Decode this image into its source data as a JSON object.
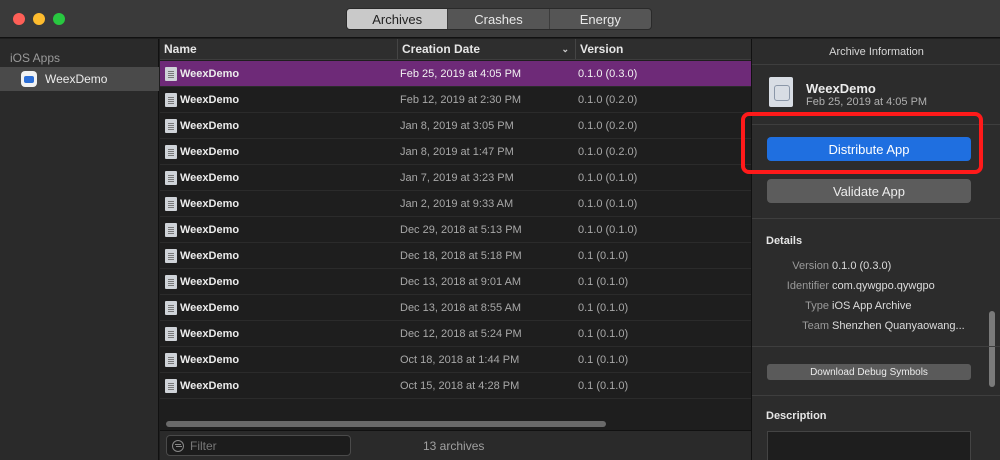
{
  "titlebar": {
    "tabs": [
      {
        "label": "Archives",
        "active": true
      },
      {
        "label": "Crashes",
        "active": false
      },
      {
        "label": "Energy",
        "active": false
      }
    ]
  },
  "sidebar": {
    "header": "iOS Apps",
    "items": [
      {
        "label": "WeexDemo",
        "icon": "app-icon",
        "selected": true
      }
    ]
  },
  "table": {
    "columns": {
      "name": "Name",
      "date": "Creation Date",
      "version": "Version"
    },
    "rows": [
      {
        "name": "WeexDemo",
        "date": "Feb 25, 2019 at 4:05 PM",
        "version": "0.1.0 (0.3.0)"
      },
      {
        "name": "WeexDemo",
        "date": "Feb 12, 2019 at 2:30 PM",
        "version": "0.1.0 (0.2.0)"
      },
      {
        "name": "WeexDemo",
        "date": "Jan 8, 2019 at 3:05 PM",
        "version": "0.1.0 (0.2.0)"
      },
      {
        "name": "WeexDemo",
        "date": "Jan 8, 2019 at 1:47 PM",
        "version": "0.1.0 (0.2.0)"
      },
      {
        "name": "WeexDemo",
        "date": "Jan 7, 2019 at 3:23 PM",
        "version": "0.1.0 (0.1.0)"
      },
      {
        "name": "WeexDemo",
        "date": "Jan 2, 2019 at 9:33 AM",
        "version": "0.1.0 (0.1.0)"
      },
      {
        "name": "WeexDemo",
        "date": "Dec 29, 2018 at 5:13 PM",
        "version": "0.1.0 (0.1.0)"
      },
      {
        "name": "WeexDemo",
        "date": "Dec 18, 2018 at 5:18 PM",
        "version": "0.1 (0.1.0)"
      },
      {
        "name": "WeexDemo",
        "date": "Dec 13, 2018 at 9:01 AM",
        "version": "0.1 (0.1.0)"
      },
      {
        "name": "WeexDemo",
        "date": "Dec 13, 2018 at 8:55 AM",
        "version": "0.1 (0.1.0)"
      },
      {
        "name": "WeexDemo",
        "date": "Dec 12, 2018 at 5:24 PM",
        "version": "0.1 (0.1.0)"
      },
      {
        "name": "WeexDemo",
        "date": "Oct 18, 2018 at 1:44 PM",
        "version": "0.1 (0.1.0)"
      },
      {
        "name": "WeexDemo",
        "date": "Oct 15, 2018 at 4:28 PM",
        "version": "0.1 (0.1.0)"
      }
    ],
    "filter_placeholder": "Filter",
    "count_label": "13 archives"
  },
  "inspector": {
    "header": "Archive Information",
    "title": "WeexDemo",
    "subtitle": "Feb 25, 2019 at 4:05 PM",
    "distribute_label": "Distribute App",
    "validate_label": "Validate App",
    "details_title": "Details",
    "details": [
      {
        "key": "Version",
        "value": "0.1.0 (0.3.0)"
      },
      {
        "key": "Identifier",
        "value": "com.qywgpo.qywgpo"
      },
      {
        "key": "Type",
        "value": "iOS App Archive"
      },
      {
        "key": "Team",
        "value": "Shenzhen Quanyaowang..."
      }
    ],
    "debug_symbols_label": "Download Debug Symbols",
    "description_title": "Description"
  },
  "colors": {
    "selected_row": "#6e2a78",
    "primary_button": "#1f6fe0",
    "highlight": "#ff1a1a"
  }
}
